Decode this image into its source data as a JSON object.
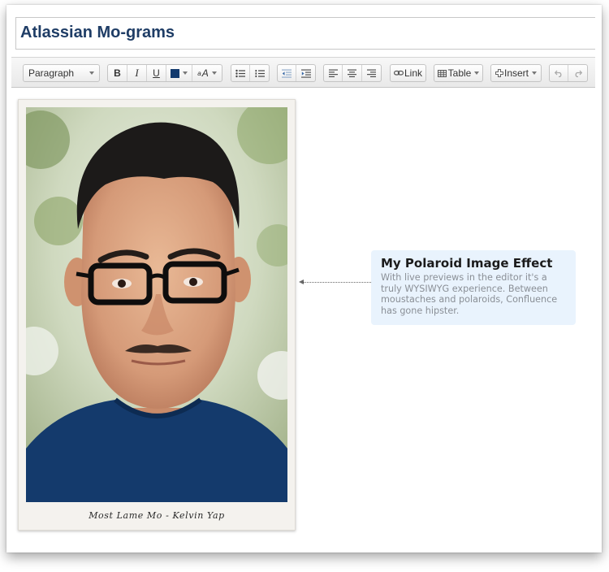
{
  "page": {
    "title": "Atlassian Mo-grams"
  },
  "toolbar": {
    "paragraph_label": "Paragraph",
    "bold_label": "B",
    "italic_label": "I",
    "underline_label": "U",
    "text_color": "#123a6e",
    "font_size_label": "A",
    "link_label": "Link",
    "table_label": "Table",
    "insert_label": "Insert",
    "icons": [
      "bold-icon",
      "italic-icon",
      "underline-icon",
      "text-color-icon",
      "font-size-icon",
      "bullet-list-icon",
      "numbered-list-icon",
      "outdent-icon",
      "indent-icon",
      "align-left-icon",
      "align-center-icon",
      "align-right-icon",
      "link-icon",
      "table-icon",
      "plus-icon",
      "undo-icon",
      "redo-icon"
    ]
  },
  "polaroid": {
    "caption": "Most Lame Mo - Kelvin Yap"
  },
  "callout": {
    "title": "My Polaroid Image Effect",
    "body": "With live previews in the editor it's a truly WYSIWYG experience. Between moustaches and polaroids, Confluence has gone hipster."
  },
  "colors": {
    "title": "#1f3d66",
    "callout_bg": "#e9f3fd",
    "shirt": "#123a6e"
  }
}
